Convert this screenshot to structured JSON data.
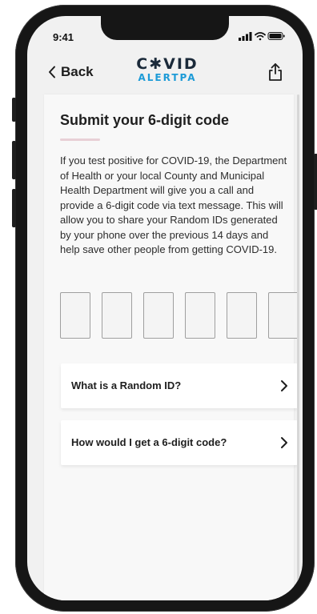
{
  "status_bar": {
    "time": "9:41"
  },
  "header": {
    "back_label": "Back",
    "logo_top": "C✱VID",
    "logo_bottom": "ALERTPA"
  },
  "content": {
    "title": "Submit your 6-digit code",
    "description": "If you test positive for COVID-19, the Department of Health or your local County and Municipal Health Department will give you a call and provide a 6-digit code via text message. This will allow you to share your Random IDs generated by your phone over the previous 14 days and help save other people from getting COVID-19.",
    "code_inputs": [
      "",
      "",
      "",
      "",
      "",
      ""
    ]
  },
  "faq": [
    {
      "label": "What is a Random ID?"
    },
    {
      "label": "How would I get a 6-digit code?"
    }
  ],
  "colors": {
    "accent": "#1d9bd7",
    "underline": "#e8d0d6",
    "text": "#1e1e1e"
  }
}
